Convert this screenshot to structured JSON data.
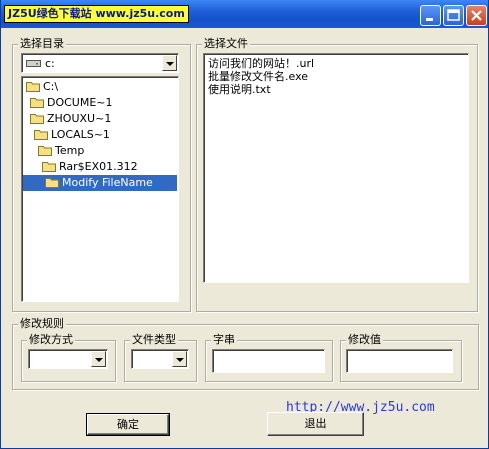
{
  "window": {
    "title": "JZ5U绿色下载站 www.jz5u.com"
  },
  "dir_panel": {
    "label": "选择目录",
    "drive": "c:",
    "tree": [
      {
        "label": "C:\\"
      },
      {
        "label": "DOCUME~1"
      },
      {
        "label": "ZHOUXU~1"
      },
      {
        "label": "LOCALS~1"
      },
      {
        "label": "Temp"
      },
      {
        "label": "Rar$EX01.312"
      },
      {
        "label": "Modify FileName",
        "selected": true
      }
    ]
  },
  "file_panel": {
    "label": "选择文件",
    "files": [
      "访问我们的网站！.url",
      "批量修改文件名.exe",
      "使用说明.txt"
    ]
  },
  "rules": {
    "label": "修改规则",
    "method_label": "修改方式",
    "type_label": "文件类型",
    "string_label": "字串",
    "value_label": "修改值"
  },
  "buttons": {
    "ok": "确定",
    "exit": "退出"
  },
  "website": "http://www.jz5u.com",
  "colors": {
    "title_bar": "#1f5fd8",
    "selection": "#316ac5",
    "link": "#2a3bd6"
  }
}
